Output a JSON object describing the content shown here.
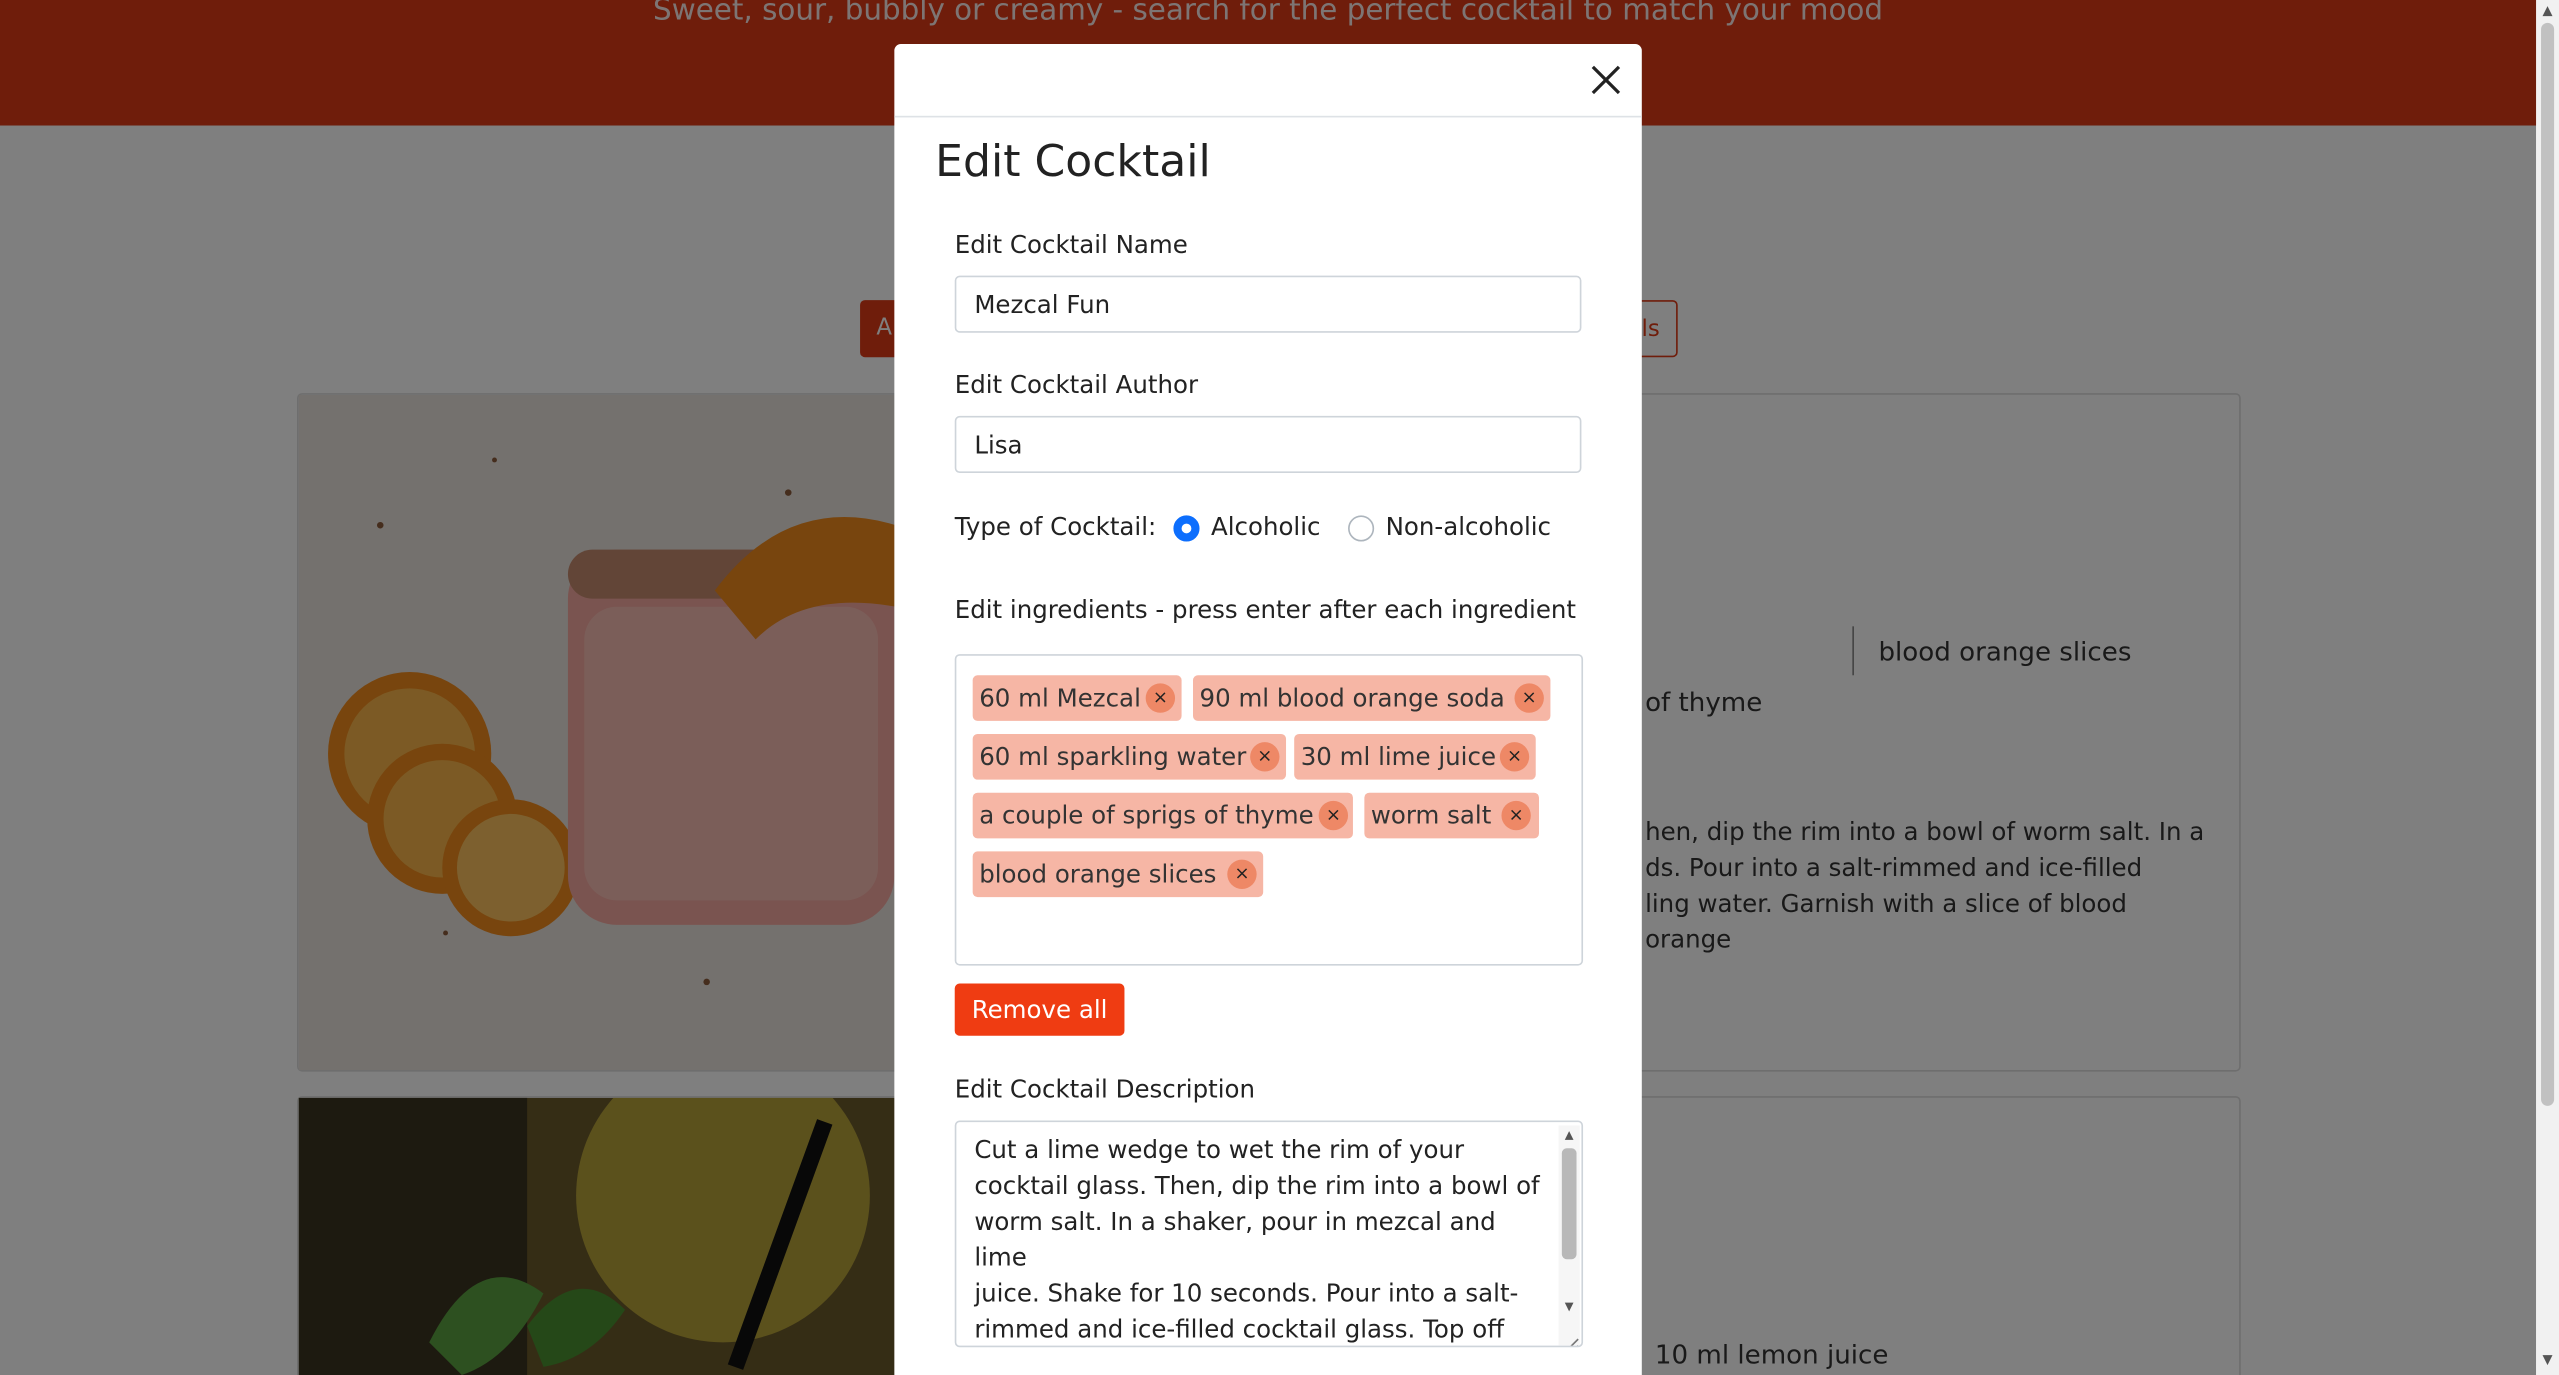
{
  "page": {
    "hero_subtitle": "Sweet, sour, bubbly or creamy - search for the perfect cocktail to match your mood",
    "filter_primary_label": "A",
    "filter_outline_label": "ls",
    "card1": {
      "ingredient_fragment_1": "blood orange slices",
      "ingredient_fragment_2": "of thyme",
      "description_fragment": "hen, dip the rim into a bowl of worm salt. In a\nds. Pour into a salt-rimmed and ice-filled\nling water. Garnish with a slice of blood orange"
    },
    "card2": {
      "ingredient_fragment": "10 ml lemon juice"
    }
  },
  "modal": {
    "title": "Edit Cocktail",
    "close_icon": "close-icon",
    "name_label": "Edit Cocktail Name",
    "name_value": "Mezcal Fun",
    "author_label": "Edit Cocktail Author",
    "author_value": "Lisa",
    "type_label": "Type of Cocktail:",
    "type_options": [
      {
        "label": "Alcoholic",
        "checked": true
      },
      {
        "label": "Non-alcoholic",
        "checked": false
      }
    ],
    "ingredients_label": "Edit ingredients - press enter after each ingredient",
    "ingredients": [
      "60 ml Mezcal",
      "90 ml blood orange soda",
      "60 ml sparkling water",
      "30 ml lime juice",
      "a couple of sprigs of thyme",
      "worm salt",
      "blood orange slices"
    ],
    "tag_remove_symbol": "×",
    "remove_all_label": "Remove all",
    "description_label": "Edit Cocktail Description",
    "description_value": "Cut a lime wedge to wet the rim of your\ncocktail glass. Then, dip the rim into a bowl of\nworm salt. In a shaker, pour in mezcal and lime\njuice. Shake for 10 seconds. Pour into a salt-\nrimmed and ice-filled cocktail glass. Top off\nwith blood orange soda and sparkling water."
  },
  "colors": {
    "brand_red": "#df3b17",
    "button_red": "#ef3c12",
    "tag_bg": "#f6b6a5",
    "radio_blue": "#0d6efd"
  }
}
